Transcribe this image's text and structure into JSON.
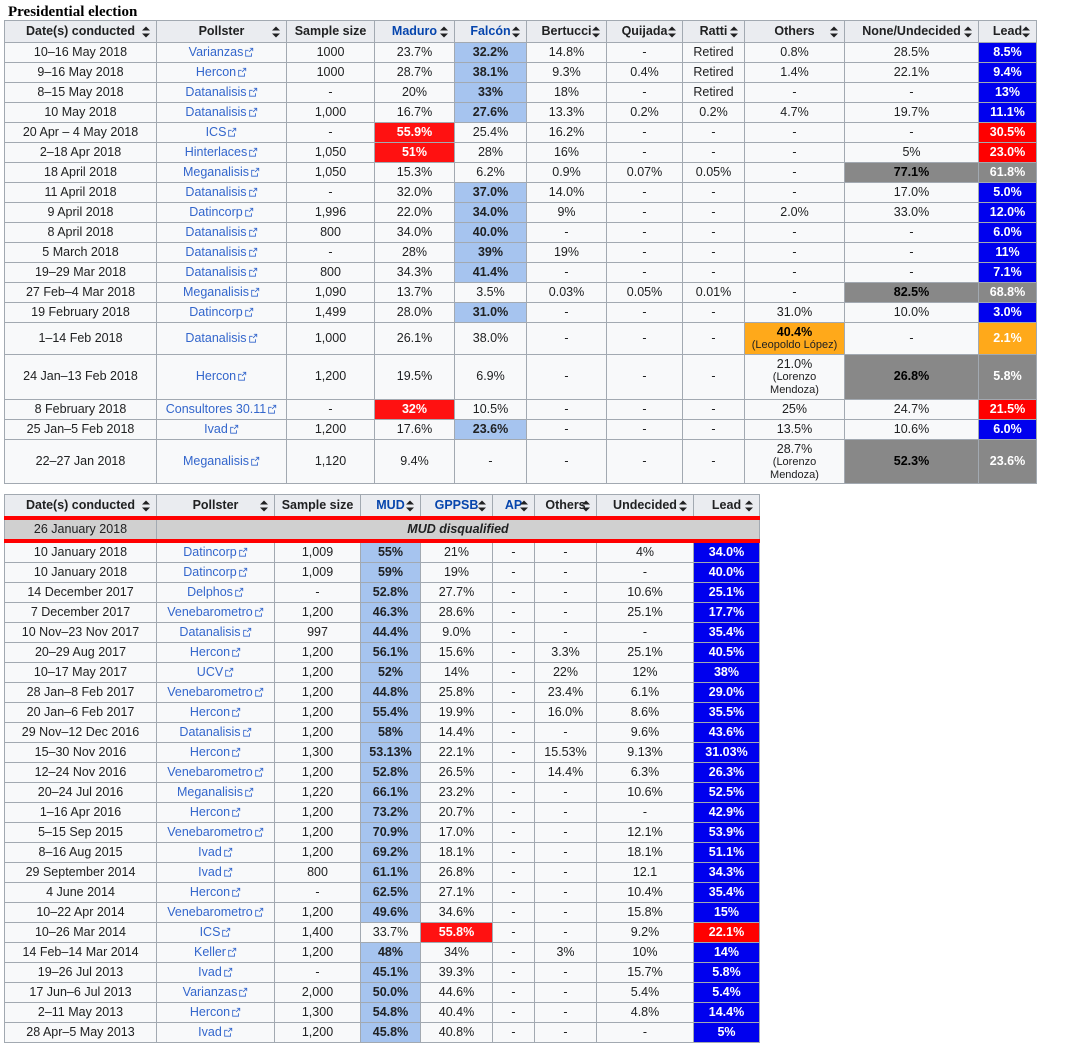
{
  "section": {
    "title": "Presidential election"
  },
  "icons": {
    "sort": "sort-arrows-icon",
    "external_link": "external-link-icon"
  },
  "colors": {
    "lead_blue": "#0000ee",
    "lead_red": "#ff0000",
    "lead_grey": "#888888",
    "lead_orange": "#ffa91a",
    "cell_lightblue": "#a6c4ef",
    "cell_red": "#ff1111",
    "cell_grey": "#888888",
    "cell_orange": "#ffa91a",
    "header_bg": "#eaecf0",
    "link": "#3366cc",
    "disqualified_rule": "#ff0000"
  },
  "table1": {
    "name": "presidential-election-polls",
    "headers": [
      {
        "label": "Date(s) conducted",
        "sortable": true,
        "party": false
      },
      {
        "label": "Pollster",
        "sortable": true,
        "party": false
      },
      {
        "label": "Sample size",
        "sortable": false,
        "party": false
      },
      {
        "label": "Maduro",
        "sortable": true,
        "party": true
      },
      {
        "label": "Falcón",
        "sortable": true,
        "party": true
      },
      {
        "label": "Bertucci",
        "sortable": true,
        "party": false
      },
      {
        "label": "Quijada",
        "sortable": true,
        "party": false
      },
      {
        "label": "Ratti",
        "sortable": true,
        "party": false
      },
      {
        "label": "Others",
        "sortable": true,
        "party": false
      },
      {
        "label": "None/Undecided",
        "sortable": true,
        "party": false
      },
      {
        "label": "Lead",
        "sortable": true,
        "party": false
      }
    ],
    "rows": [
      {
        "date": "10–16 May 2018",
        "pollster": "Varianzas",
        "sample": "1000",
        "maduro": "23.7%",
        "falcon": "32.2%",
        "bertucci": "14.8%",
        "quijada": "-",
        "ratti": "Retired",
        "others": "0.8%",
        "none": "28.5%",
        "lead": "8.5%",
        "style": {
          "falcon": "hl-lightblue",
          "lead": "lead-blue"
        }
      },
      {
        "date": "9–16 May 2018",
        "pollster": "Hercon",
        "sample": "1000",
        "maduro": "28.7%",
        "falcon": "38.1%",
        "bertucci": "9.3%",
        "quijada": "0.4%",
        "ratti": "Retired",
        "others": "1.4%",
        "none": "22.1%",
        "lead": "9.4%",
        "style": {
          "falcon": "hl-lightblue",
          "lead": "lead-blue"
        }
      },
      {
        "date": "8–15 May 2018",
        "pollster": "Datanalisis",
        "sample": "-",
        "maduro": "20%",
        "falcon": "33%",
        "bertucci": "18%",
        "quijada": "-",
        "ratti": "Retired",
        "others": "-",
        "none": "-",
        "lead": "13%",
        "style": {
          "falcon": "hl-lightblue",
          "lead": "lead-blue"
        }
      },
      {
        "date": "10 May 2018",
        "pollster": "Datanalisis",
        "sample": "1,000",
        "maduro": "16.7%",
        "falcon": "27.6%",
        "bertucci": "13.3%",
        "quijada": "0.2%",
        "ratti": "0.2%",
        "others": "4.7%",
        "none": "19.7%",
        "lead": "11.1%",
        "style": {
          "falcon": "hl-lightblue",
          "lead": "lead-blue"
        }
      },
      {
        "date": "20 Apr – 4 May 2018",
        "pollster": "ICS",
        "sample": "-",
        "maduro": "55.9%",
        "falcon": "25.4%",
        "bertucci": "16.2%",
        "quijada": "-",
        "ratti": "-",
        "others": "-",
        "none": "-",
        "lead": "30.5%",
        "style": {
          "maduro": "hl-red",
          "lead": "lead-red"
        }
      },
      {
        "date": "2–18 Apr 2018",
        "pollster": "Hinterlaces",
        "sample": "1,050",
        "maduro": "51%",
        "falcon": "28%",
        "bertucci": "16%",
        "quijada": "-",
        "ratti": "-",
        "others": "-",
        "none": "5%",
        "lead": "23.0%",
        "style": {
          "maduro": "hl-red",
          "lead": "lead-red"
        }
      },
      {
        "date": "18 April 2018",
        "pollster": "Meganalisis",
        "sample": "1,050",
        "maduro": "15.3%",
        "falcon": "6.2%",
        "bertucci": "0.9%",
        "quijada": "0.07%",
        "ratti": "0.05%",
        "others": "-",
        "none": "77.1%",
        "lead": "61.8%",
        "style": {
          "none": "hl-grey",
          "lead": "lead-grey"
        }
      },
      {
        "date": "11 April 2018",
        "pollster": "Datanalisis",
        "sample": "-",
        "maduro": "32.0%",
        "falcon": "37.0%",
        "bertucci": "14.0%",
        "quijada": "-",
        "ratti": "-",
        "others": "-",
        "none": "17.0%",
        "lead": "5.0%",
        "style": {
          "falcon": "hl-lightblue",
          "lead": "lead-blue"
        }
      },
      {
        "date": "9 April 2018",
        "pollster": "Datincorp",
        "sample": "1,996",
        "maduro": "22.0%",
        "falcon": "34.0%",
        "bertucci": "9%",
        "quijada": "-",
        "ratti": "-",
        "others": "2.0%",
        "none": "33.0%",
        "lead": "12.0%",
        "style": {
          "falcon": "hl-lightblue",
          "lead": "lead-blue"
        }
      },
      {
        "date": "8 April 2018",
        "pollster": "Datanalisis",
        "sample": "800",
        "maduro": "34.0%",
        "falcon": "40.0%",
        "bertucci": "-",
        "quijada": "-",
        "ratti": "-",
        "others": "-",
        "none": "-",
        "lead": "6.0%",
        "style": {
          "falcon": "hl-lightblue",
          "lead": "lead-blue"
        }
      },
      {
        "date": "5 March 2018",
        "pollster": "Datanalisis",
        "sample": "-",
        "maduro": "28%",
        "falcon": "39%",
        "bertucci": "19%",
        "quijada": "-",
        "ratti": "-",
        "others": "-",
        "none": "-",
        "lead": "11%",
        "style": {
          "falcon": "hl-lightblue",
          "lead": "lead-blue"
        }
      },
      {
        "date": "19–29 Mar 2018",
        "pollster": "Datanalisis",
        "sample": "800",
        "maduro": "34.3%",
        "falcon": "41.4%",
        "bertucci": "-",
        "quijada": "-",
        "ratti": "-",
        "others": "-",
        "none": "-",
        "lead": "7.1%",
        "style": {
          "falcon": "hl-lightblue",
          "lead": "lead-blue"
        }
      },
      {
        "date": "27 Feb–4 Mar 2018",
        "pollster": "Meganalisis",
        "sample": "1,090",
        "maduro": "13.7%",
        "falcon": "3.5%",
        "bertucci": "0.03%",
        "quijada": "0.05%",
        "ratti": "0.01%",
        "others": "-",
        "none": "82.5%",
        "lead": "68.8%",
        "style": {
          "none": "hl-grey",
          "lead": "lead-grey"
        }
      },
      {
        "date": "19 February 2018",
        "pollster": "Datincorp",
        "sample": "1,499",
        "maduro": "28.0%",
        "falcon": "31.0%",
        "bertucci": "-",
        "quijada": "-",
        "ratti": "-",
        "others": "31.0%",
        "none": "10.0%",
        "lead": "3.0%",
        "style": {
          "falcon": "hl-lightblue",
          "lead": "lead-blue"
        }
      },
      {
        "date": "1–14 Feb 2018",
        "pollster": "Datanalisis",
        "sample": "1,000",
        "maduro": "26.1%",
        "falcon": "38.0%",
        "bertucci": "-",
        "quijada": "-",
        "ratti": "-",
        "others": "40.4%",
        "others_sub": "(Leopoldo López)",
        "none": "-",
        "lead": "2.1%",
        "style": {
          "others": "hl-orange",
          "lead": "lead-orange"
        }
      },
      {
        "date": "24 Jan–13 Feb 2018",
        "pollster": "Hercon",
        "sample": "1,200",
        "maduro": "19.5%",
        "falcon": "6.9%",
        "bertucci": "-",
        "quijada": "-",
        "ratti": "-",
        "others": "21.0%",
        "others_sub": "(Lorenzo Mendoza)",
        "none": "26.8%",
        "lead": "5.8%",
        "style": {
          "none": "hl-grey",
          "lead": "lead-grey"
        }
      },
      {
        "date": "8 February 2018",
        "pollster": "Consultores 30.11",
        "sample": "-",
        "maduro": "32%",
        "falcon": "10.5%",
        "bertucci": "-",
        "quijada": "-",
        "ratti": "-",
        "others": "25%",
        "none": "24.7%",
        "lead": "21.5%",
        "style": {
          "maduro": "hl-red",
          "lead": "lead-red"
        }
      },
      {
        "date": "25 Jan–5 Feb 2018",
        "pollster": "Ivad",
        "sample": "1,200",
        "maduro": "17.6%",
        "falcon": "23.6%",
        "bertucci": "-",
        "quijada": "-",
        "ratti": "-",
        "others": "13.5%",
        "none": "10.6%",
        "lead": "6.0%",
        "style": {
          "falcon": "hl-lightblue",
          "lead": "lead-blue"
        }
      },
      {
        "date": "22–27 Jan 2018",
        "pollster": "Meganalisis",
        "sample": "1,120",
        "maduro": "9.4%",
        "falcon": "-",
        "bertucci": "-",
        "quijada": "-",
        "ratti": "-",
        "others": "28.7%",
        "others_sub": "(Lorenzo Mendoza)",
        "none": "52.3%",
        "lead": "23.6%",
        "style": {
          "none": "hl-grey",
          "lead": "lead-grey"
        }
      }
    ]
  },
  "table2": {
    "name": "mud-vs-gppsb-polls",
    "headers": [
      {
        "label": "Date(s) conducted",
        "sortable": true,
        "party": false
      },
      {
        "label": "Pollster",
        "sortable": true,
        "party": false
      },
      {
        "label": "Sample size",
        "sortable": false,
        "party": false
      },
      {
        "label": "MUD",
        "sortable": true,
        "party": true
      },
      {
        "label": "GPPSB",
        "sortable": true,
        "party": true
      },
      {
        "label": "AP",
        "sortable": true,
        "party": true
      },
      {
        "label": "Others",
        "sortable": true,
        "party": false
      },
      {
        "label": "Undecided",
        "sortable": true,
        "party": false
      },
      {
        "label": "Lead",
        "sortable": true,
        "party": false
      }
    ],
    "disqualified": {
      "date": "26 January 2018",
      "note": "MUD disqualified"
    },
    "rows": [
      {
        "date": "10 January 2018",
        "pollster": "Datincorp",
        "sample": "1,009",
        "mud": "55%",
        "gppsb": "21%",
        "ap": "-",
        "others": "-",
        "undecided": "4%",
        "lead": "34.0%",
        "style": {
          "mud": "hl-lightblue",
          "lead": "lead-blue"
        }
      },
      {
        "date": "10 January 2018",
        "pollster": "Datincorp",
        "sample": "1,009",
        "mud": "59%",
        "gppsb": "19%",
        "ap": "-",
        "others": "-",
        "undecided": "-",
        "lead": "40.0%",
        "style": {
          "mud": "hl-lightblue",
          "lead": "lead-blue"
        }
      },
      {
        "date": "14 December 2017",
        "pollster": "Delphos",
        "sample": "-",
        "mud": "52.8%",
        "gppsb": "27.7%",
        "ap": "-",
        "others": "-",
        "undecided": "10.6%",
        "lead": "25.1%",
        "style": {
          "mud": "hl-lightblue",
          "lead": "lead-blue"
        }
      },
      {
        "date": "7 December 2017",
        "pollster": "Venebarometro",
        "sample": "1,200",
        "mud": "46.3%",
        "gppsb": "28.6%",
        "ap": "-",
        "others": "-",
        "undecided": "25.1%",
        "lead": "17.7%",
        "style": {
          "mud": "hl-lightblue",
          "lead": "lead-blue"
        }
      },
      {
        "date": "10 Nov–23 Nov 2017",
        "pollster": "Datanalisis",
        "sample": "997",
        "mud": "44.4%",
        "gppsb": "9.0%",
        "ap": "-",
        "others": "-",
        "undecided": "-",
        "lead": "35.4%",
        "style": {
          "mud": "hl-lightblue",
          "lead": "lead-blue"
        }
      },
      {
        "date": "20–29 Aug 2017",
        "pollster": "Hercon",
        "sample": "1,200",
        "mud": "56.1%",
        "gppsb": "15.6%",
        "ap": "-",
        "others": "3.3%",
        "undecided": "25.1%",
        "lead": "40.5%",
        "style": {
          "mud": "hl-lightblue",
          "lead": "lead-blue"
        }
      },
      {
        "date": "10–17 May 2017",
        "pollster": "UCV",
        "sample": "1,200",
        "mud": "52%",
        "gppsb": "14%",
        "ap": "-",
        "others": "22%",
        "undecided": "12%",
        "lead": "38%",
        "style": {
          "mud": "hl-lightblue",
          "lead": "lead-blue"
        }
      },
      {
        "date": "28 Jan–8 Feb 2017",
        "pollster": "Venebarometro",
        "sample": "1,200",
        "mud": "44.8%",
        "gppsb": "25.8%",
        "ap": "-",
        "others": "23.4%",
        "undecided": "6.1%",
        "lead": "29.0%",
        "style": {
          "mud": "hl-lightblue",
          "lead": "lead-blue"
        }
      },
      {
        "date": "20 Jan–6 Feb 2017",
        "pollster": "Hercon",
        "sample": "1,200",
        "mud": "55.4%",
        "gppsb": "19.9%",
        "ap": "-",
        "others": "16.0%",
        "undecided": "8.6%",
        "lead": "35.5%",
        "style": {
          "mud": "hl-lightblue",
          "lead": "lead-blue"
        }
      },
      {
        "date": "29 Nov–12 Dec 2016",
        "pollster": "Datanalisis",
        "sample": "1,200",
        "mud": "58%",
        "gppsb": "14.4%",
        "ap": "-",
        "others": "-",
        "undecided": "9.6%",
        "lead": "43.6%",
        "style": {
          "mud": "hl-lightblue",
          "lead": "lead-blue"
        }
      },
      {
        "date": "15–30 Nov 2016",
        "pollster": "Hercon",
        "sample": "1,300",
        "mud": "53.13%",
        "gppsb": "22.1%",
        "ap": "-",
        "others": "15.53%",
        "undecided": "9.13%",
        "lead": "31.03%",
        "style": {
          "mud": "hl-lightblue",
          "lead": "lead-blue"
        }
      },
      {
        "date": "12–24 Nov 2016",
        "pollster": "Venebarometro",
        "sample": "1,200",
        "mud": "52.8%",
        "gppsb": "26.5%",
        "ap": "-",
        "others": "14.4%",
        "undecided": "6.3%",
        "lead": "26.3%",
        "style": {
          "mud": "hl-lightblue",
          "lead": "lead-blue"
        }
      },
      {
        "date": "20–24 Jul 2016",
        "pollster": "Meganalisis",
        "sample": "1,220",
        "mud": "66.1%",
        "gppsb": "23.2%",
        "ap": "-",
        "others": "-",
        "undecided": "10.6%",
        "lead": "52.5%",
        "style": {
          "mud": "hl-lightblue",
          "lead": "lead-blue"
        }
      },
      {
        "date": "1–16 Apr 2016",
        "pollster": "Hercon",
        "sample": "1,200",
        "mud": "73.2%",
        "gppsb": "20.7%",
        "ap": "-",
        "others": "-",
        "undecided": "-",
        "lead": "42.9%",
        "style": {
          "mud": "hl-lightblue",
          "lead": "lead-blue"
        }
      },
      {
        "date": "5–15 Sep 2015",
        "pollster": "Venebarometro",
        "sample": "1,200",
        "mud": "70.9%",
        "gppsb": "17.0%",
        "ap": "-",
        "others": "-",
        "undecided": "12.1%",
        "lead": "53.9%",
        "style": {
          "mud": "hl-lightblue",
          "lead": "lead-blue"
        }
      },
      {
        "date": "8–16 Aug 2015",
        "pollster": "Ivad",
        "sample": "1,200",
        "mud": "69.2%",
        "gppsb": "18.1%",
        "ap": "-",
        "others": "-",
        "undecided": "18.1%",
        "lead": "51.1%",
        "style": {
          "mud": "hl-lightblue",
          "lead": "lead-blue"
        }
      },
      {
        "date": "29 September 2014",
        "pollster": "Ivad",
        "sample": "800",
        "mud": "61.1%",
        "gppsb": "26.8%",
        "ap": "-",
        "others": "-",
        "undecided": "12.1",
        "lead": "34.3%",
        "style": {
          "mud": "hl-lightblue",
          "lead": "lead-blue"
        }
      },
      {
        "date": "4 June 2014",
        "pollster": "Hercon",
        "sample": "-",
        "mud": "62.5%",
        "gppsb": "27.1%",
        "ap": "-",
        "others": "-",
        "undecided": "10.4%",
        "lead": "35.4%",
        "style": {
          "mud": "hl-lightblue",
          "lead": "lead-blue"
        }
      },
      {
        "date": "10–22 Apr 2014",
        "pollster": "Venebarometro",
        "sample": "1,200",
        "mud": "49.6%",
        "gppsb": "34.6%",
        "ap": "-",
        "others": "-",
        "undecided": "15.8%",
        "lead": "15%",
        "style": {
          "mud": "hl-lightblue",
          "lead": "lead-blue"
        }
      },
      {
        "date": "10–26 Mar 2014",
        "pollster": "ICS",
        "sample": "1,400",
        "mud": "33.7%",
        "gppsb": "55.8%",
        "ap": "-",
        "others": "-",
        "undecided": "9.2%",
        "lead": "22.1%",
        "style": {
          "gppsb": "hl-red",
          "lead": "lead-red"
        }
      },
      {
        "date": "14 Feb–14 Mar 2014",
        "pollster": "Keller",
        "sample": "1,200",
        "mud": "48%",
        "gppsb": "34%",
        "ap": "-",
        "others": "3%",
        "undecided": "10%",
        "lead": "14%",
        "style": {
          "mud": "hl-lightblue",
          "lead": "lead-blue"
        }
      },
      {
        "date": "19–26 Jul 2013",
        "pollster": "Ivad",
        "sample": "-",
        "mud": "45.1%",
        "gppsb": "39.3%",
        "ap": "-",
        "others": "-",
        "undecided": "15.7%",
        "lead": "5.8%",
        "style": {
          "mud": "hl-lightblue",
          "lead": "lead-blue"
        }
      },
      {
        "date": "17 Jun–6 Jul 2013",
        "pollster": "Varianzas",
        "sample": "2,000",
        "mud": "50.0%",
        "gppsb": "44.6%",
        "ap": "-",
        "others": "-",
        "undecided": "5.4%",
        "lead": "5.4%",
        "style": {
          "mud": "hl-lightblue",
          "lead": "lead-blue"
        }
      },
      {
        "date": "2–11 May 2013",
        "pollster": "Hercon",
        "sample": "1,300",
        "mud": "54.8%",
        "gppsb": "40.4%",
        "ap": "-",
        "others": "-",
        "undecided": "4.8%",
        "lead": "14.4%",
        "style": {
          "mud": "hl-lightblue",
          "lead": "lead-blue"
        }
      },
      {
        "date": "28 Apr–5 May 2013",
        "pollster": "Ivad",
        "sample": "1,200",
        "mud": "45.8%",
        "gppsb": "40.8%",
        "ap": "-",
        "others": "-",
        "undecided": "-",
        "lead": "5%",
        "style": {
          "mud": "hl-lightblue",
          "lead": "lead-blue"
        }
      }
    ]
  }
}
